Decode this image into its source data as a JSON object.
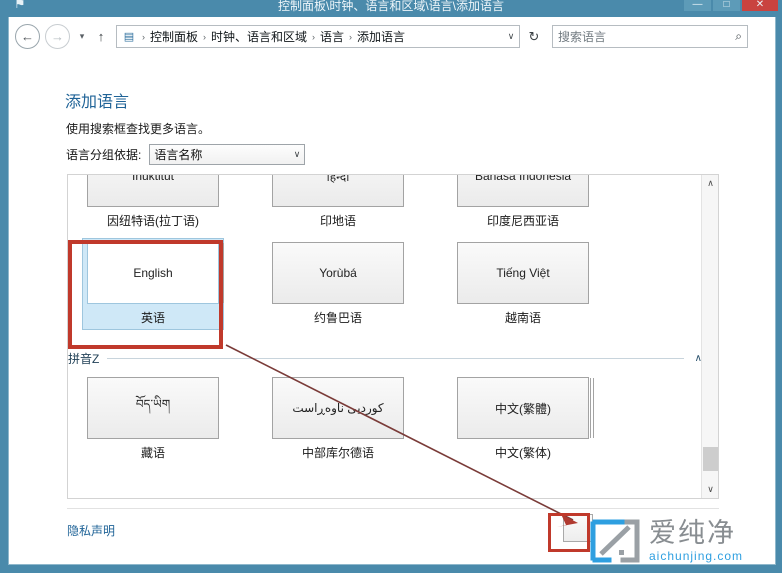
{
  "window": {
    "title": "控制面板\\时钟、语言和区域\\语言\\添加语言",
    "icon": "flag-icon",
    "minimize_label": "—",
    "maximize_label": "□",
    "close_label": "✕"
  },
  "toolbar": {
    "back_label": "←",
    "forward_label": "→",
    "recent_label": "▾",
    "up_label": "↑",
    "address_icon": "control-panel-icon",
    "breadcrumbs": [
      "控制面板",
      "时钟、语言和区域",
      "语言",
      "添加语言"
    ],
    "separator": "›",
    "address_dropdown_label": "∨",
    "refresh_label": "↻",
    "search_placeholder": "搜索语言",
    "search_value": "",
    "search_icon": "magnifier-icon"
  },
  "page": {
    "title": "添加语言",
    "subtitle": "使用搜索框查找更多语言。",
    "groupby_label": "语言分组依据:",
    "groupby_value": "语言名称",
    "groupby_arrow": "∨"
  },
  "list": {
    "rows": [
      {
        "clipped": true,
        "tiles": [
          {
            "native": "Inuktitut",
            "label": "因纽特语(拉丁语)",
            "selected": false,
            "stacked": false
          },
          {
            "native": "हिन्दी",
            "label": "印地语",
            "selected": false,
            "stacked": false
          },
          {
            "native": "Bahasa Indonesia",
            "label": "印度尼西亚语",
            "selected": false,
            "stacked": false
          }
        ]
      },
      {
        "clipped": false,
        "tiles": [
          {
            "native": "English",
            "label": "英语",
            "selected": true,
            "stacked": true
          },
          {
            "native": "Yorùbá",
            "label": "约鲁巴语",
            "selected": false,
            "stacked": false
          },
          {
            "native": "Tiếng Việt",
            "label": "越南语",
            "selected": false,
            "stacked": false
          }
        ]
      }
    ],
    "group": {
      "name": "拼音Z",
      "collapse_label": "∧",
      "tiles": [
        {
          "native": "བོད་ཡིག",
          "label": "藏语",
          "selected": false,
          "stacked": false
        },
        {
          "native": "کوردیی ناوەڕاست",
          "label": "中部库尔德语",
          "selected": false,
          "stacked": false
        },
        {
          "native": "中文(繁體)",
          "label": "中文(繁体)",
          "selected": false,
          "stacked": true
        }
      ]
    },
    "scrollbar": {
      "up_arrow": "∧",
      "down_arrow": "∨"
    }
  },
  "footer": {
    "privacy_link": "隐私声明",
    "add_button_label": ""
  },
  "watermark": {
    "cn_text": "爱纯净",
    "en_text": "aichunjing.com",
    "logo_name": "aichunjing-logo"
  },
  "colors": {
    "chrome": "#4a8aab",
    "accent_link": "#1f6397",
    "selection": "#cfe8f7",
    "annotation": "#c0392b",
    "watermark_blue": "#2e9fe0"
  }
}
